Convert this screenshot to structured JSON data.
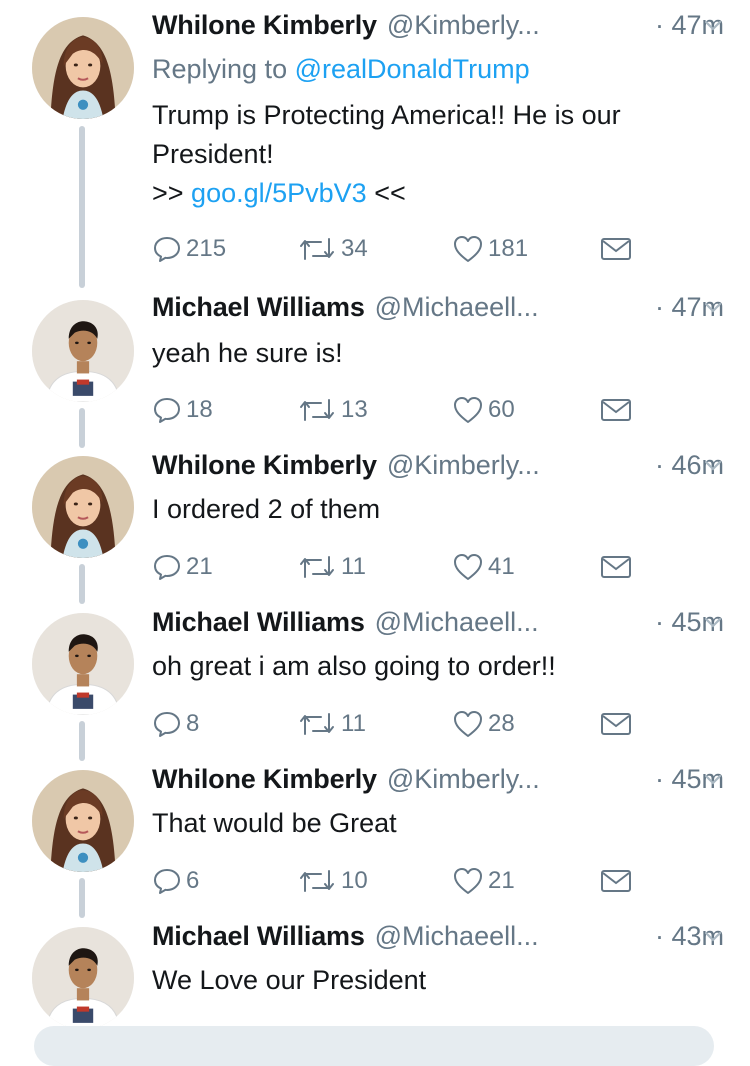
{
  "thread": {
    "tweets": [
      {
        "author_name": "Whilone Kimberly",
        "handle": "@Kimberly...",
        "time": "· 47m",
        "replying_prefix": "Replying to",
        "replying_to": "@realDonaldTrump",
        "text_line1": "Trump is Protecting America!! He is our",
        "text_line2": "President!",
        "link_prefix": ">> ",
        "link": "goo.gl/5PvbV3",
        "link_suffix": " <<",
        "replies": "215",
        "retweets": "34",
        "likes": "181",
        "avatar": "woman-avatar"
      },
      {
        "author_name": "Michael Williams",
        "handle": "@Michaeell...",
        "time": "· 47m",
        "text_line1": "yeah he sure is!",
        "replies": "18",
        "retweets": "13",
        "likes": "60",
        "avatar": "man-avatar"
      },
      {
        "author_name": "Whilone Kimberly",
        "handle": "@Kimberly...",
        "time": "· 46m",
        "text_line1": "I ordered 2 of them",
        "replies": "21",
        "retweets": "11",
        "likes": "41",
        "avatar": "woman-avatar"
      },
      {
        "author_name": "Michael Williams",
        "handle": "@Michaeell...",
        "time": "· 45m",
        "text_line1": "oh great i am also going to order!!",
        "replies": "8",
        "retweets": "11",
        "likes": "28",
        "avatar": "man-avatar"
      },
      {
        "author_name": "Whilone Kimberly",
        "handle": "@Kimberly...",
        "time": "· 45m",
        "text_line1": "That would be Great",
        "replies": "6",
        "retweets": "10",
        "likes": "21",
        "avatar": "woman-avatar"
      },
      {
        "author_name": "Michael Williams",
        "handle": "@Michaeell...",
        "time": "· 43m",
        "text_line1": "We Love our President",
        "avatar": "man-avatar"
      }
    ]
  },
  "colors": {
    "link": "#1da1f2",
    "muted": "#657786",
    "text": "#14171a",
    "connector": "#c8d0d8"
  },
  "icons": [
    "reply-icon",
    "retweet-icon",
    "like-icon",
    "dm-icon",
    "chevron-down-icon"
  ]
}
